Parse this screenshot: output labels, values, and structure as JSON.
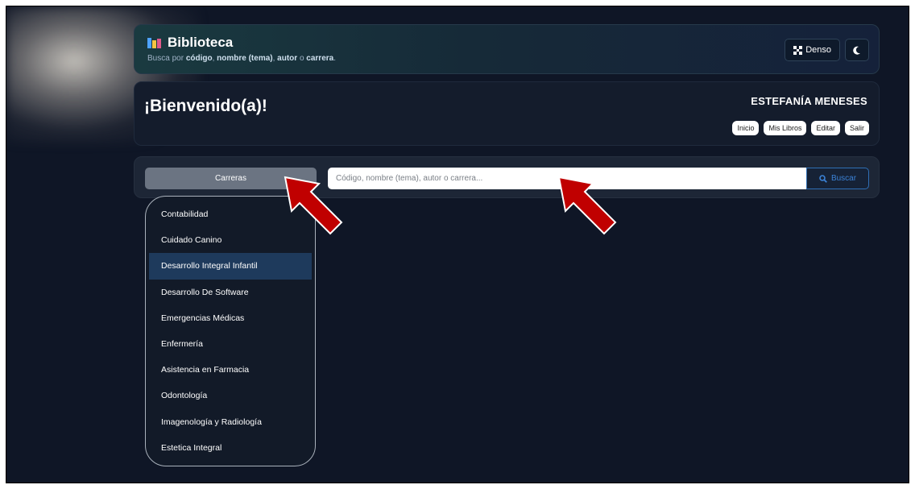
{
  "header": {
    "title": "Biblioteca",
    "subtitle_prefix": "Busca por ",
    "subtitle_code": "código",
    "subtitle_sep1": ", ",
    "subtitle_name": "nombre (tema)",
    "subtitle_sep2": ", ",
    "subtitle_author": "autor",
    "subtitle_sep3": " o ",
    "subtitle_career": "carrera",
    "subtitle_end": ".",
    "dense_label": "Denso",
    "dense_icon": "compress-icon",
    "theme_icon": "moon-icon"
  },
  "welcome": {
    "title": "¡Bienvenido(a)!",
    "user_name": "ESTEFANÍA MENESES",
    "buttons": [
      "Inicio",
      "Mis Libros",
      "Editar",
      "Salir"
    ]
  },
  "search": {
    "careers_label": "Carreras",
    "placeholder": "Código, nombre (tema), autor o carrera...",
    "button_label": "Buscar",
    "button_icon": "search-icon"
  },
  "careers": {
    "items": [
      "Contabilidad",
      "Cuidado Canino",
      "Desarrollo Integral Infantil",
      "Desarrollo De Software",
      "Emergencias Médicas",
      "Enfermería",
      "Asistencia en Farmacia",
      "Odontología",
      "Imagenología y Radiología",
      "Estetica Integral"
    ],
    "active_index": 2
  },
  "colors": {
    "background": "#0f1626",
    "accent": "#3b82d6",
    "annotation_arrow": "#c00000"
  }
}
